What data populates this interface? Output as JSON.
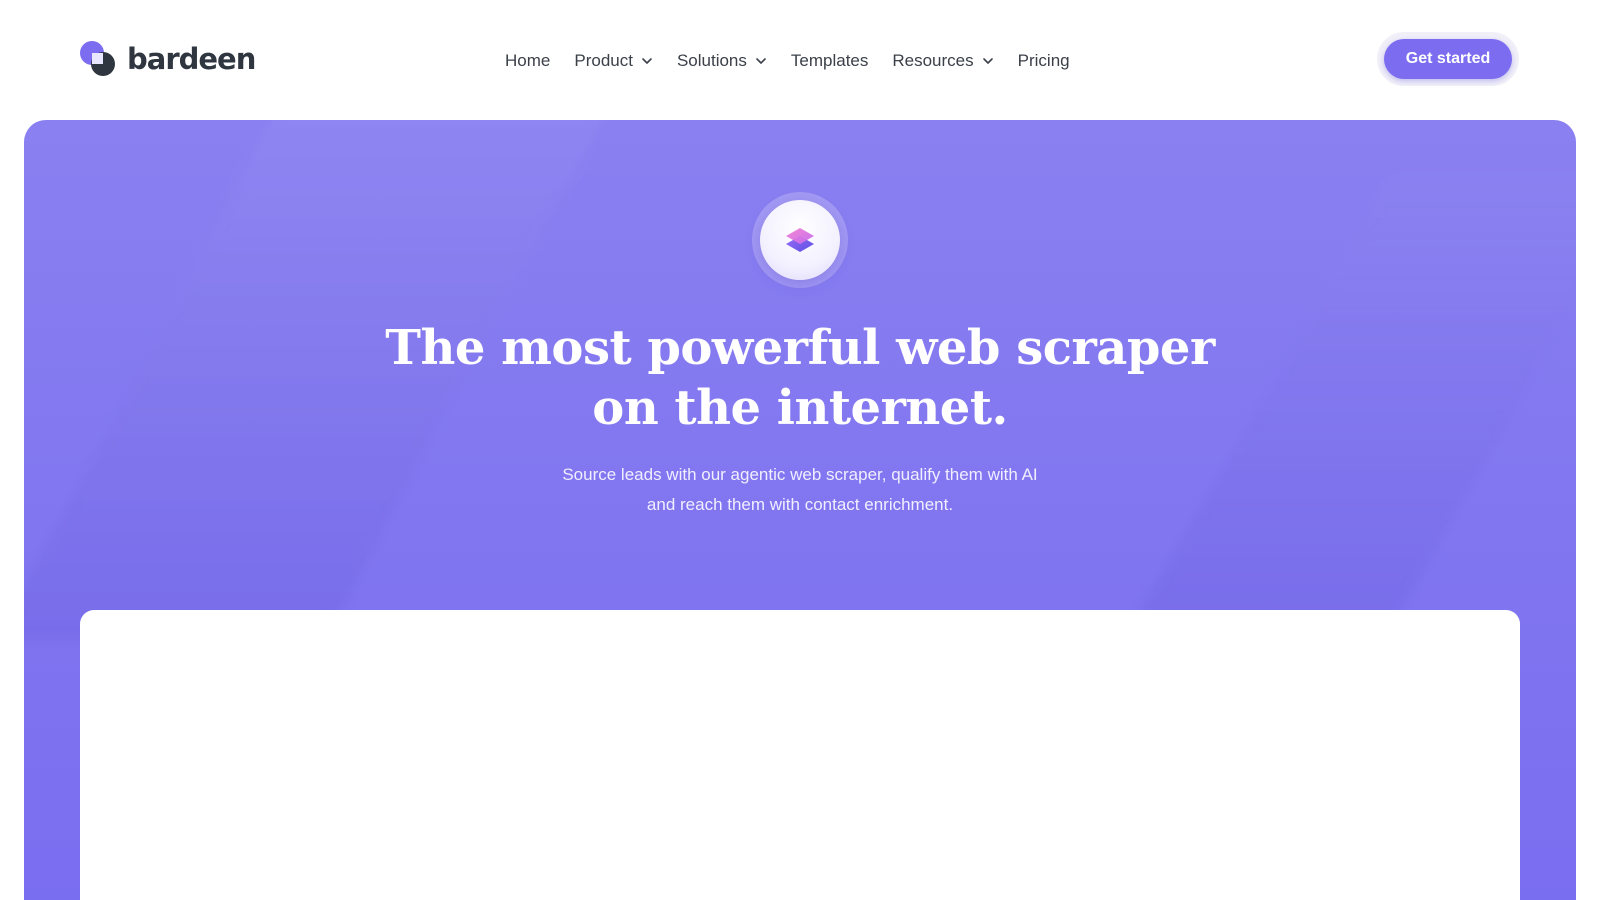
{
  "brand": {
    "name": "bardeen",
    "logo_icon": "bardeen-logo-icon",
    "primary_color": "#7b6cf0"
  },
  "nav": {
    "items": [
      {
        "label": "Home",
        "has_dropdown": false
      },
      {
        "label": "Product",
        "has_dropdown": true
      },
      {
        "label": "Solutions",
        "has_dropdown": true
      },
      {
        "label": "Templates",
        "has_dropdown": false
      },
      {
        "label": "Resources",
        "has_dropdown": true
      },
      {
        "label": "Pricing",
        "has_dropdown": false
      }
    ],
    "dropdown_icon": "chevron-down-icon"
  },
  "header": {
    "cta_label": "Get started"
  },
  "hero": {
    "icon": "layers-icon",
    "title_line1": "The most powerful web scraper",
    "title_line2": "on the internet.",
    "subtitle_line1": "Source leads with our agentic web scraper, qualify them with AI",
    "subtitle_line2": "and reach them with contact enrichment.",
    "background_color": "#8277f0"
  }
}
